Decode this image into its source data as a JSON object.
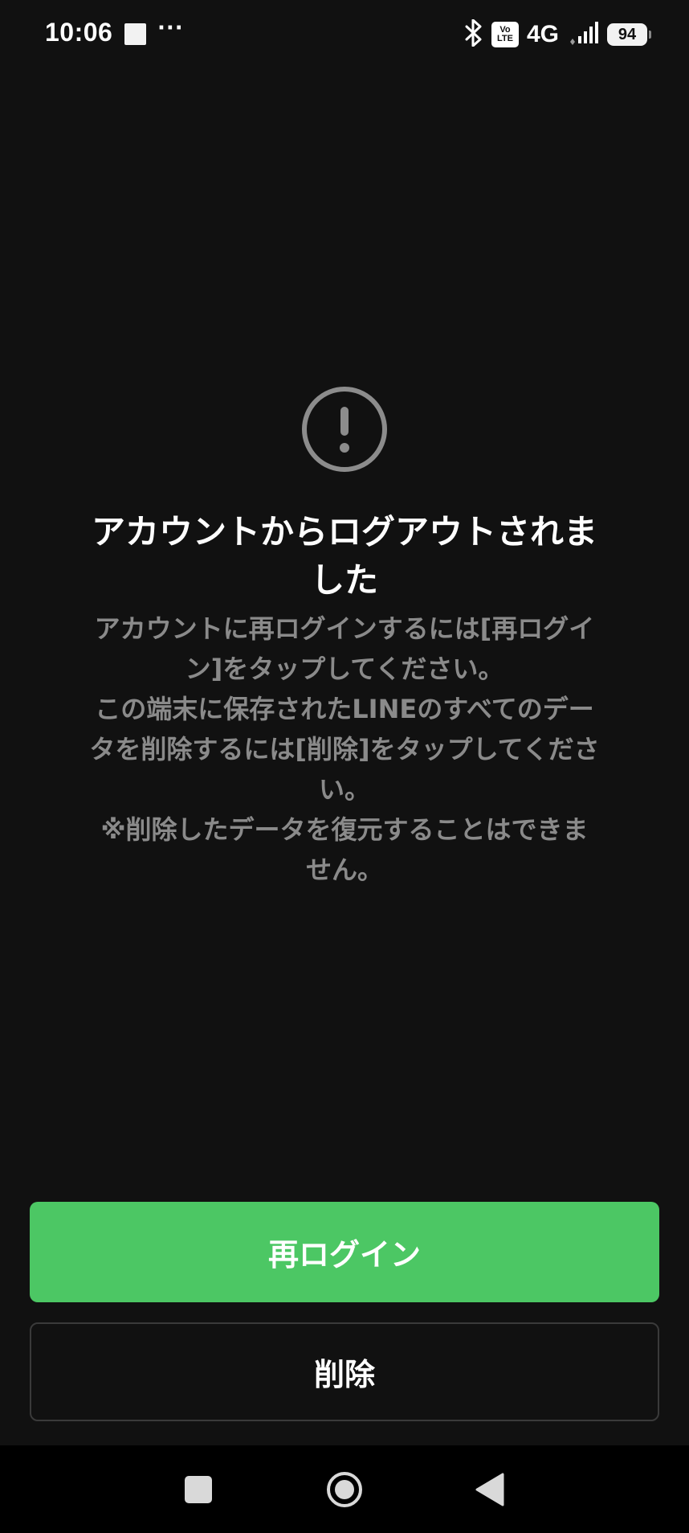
{
  "status_bar": {
    "time": "10:06",
    "more_indicator": "···",
    "volte_top": "Vo",
    "volte_bottom": "LTE",
    "network": "4G",
    "battery_level": "94",
    "icons": [
      "bluetooth-icon",
      "volte-icon",
      "signal-icon",
      "battery-icon"
    ]
  },
  "dialog": {
    "icon": "exclamation-circle-icon",
    "title": "アカウントからログアウトされました",
    "message_lines": [
      "アカウントに再ログインするには[再ログイン]をタップしてください。",
      "この端末に保存されたLINEのすべてのデータを削除するには[削除]をタップしてください。",
      "※削除したデータを復元することはできません。"
    ]
  },
  "buttons": {
    "relogin_label": "再ログイン",
    "delete_label": "削除"
  },
  "navigation": {
    "icons": [
      "recents-icon",
      "home-icon",
      "back-icon"
    ]
  },
  "colors": {
    "background": "#111111",
    "primary_green": "#4cc764",
    "secondary_text": "#8a8a8a",
    "icon_gray": "#8c8c8c"
  }
}
